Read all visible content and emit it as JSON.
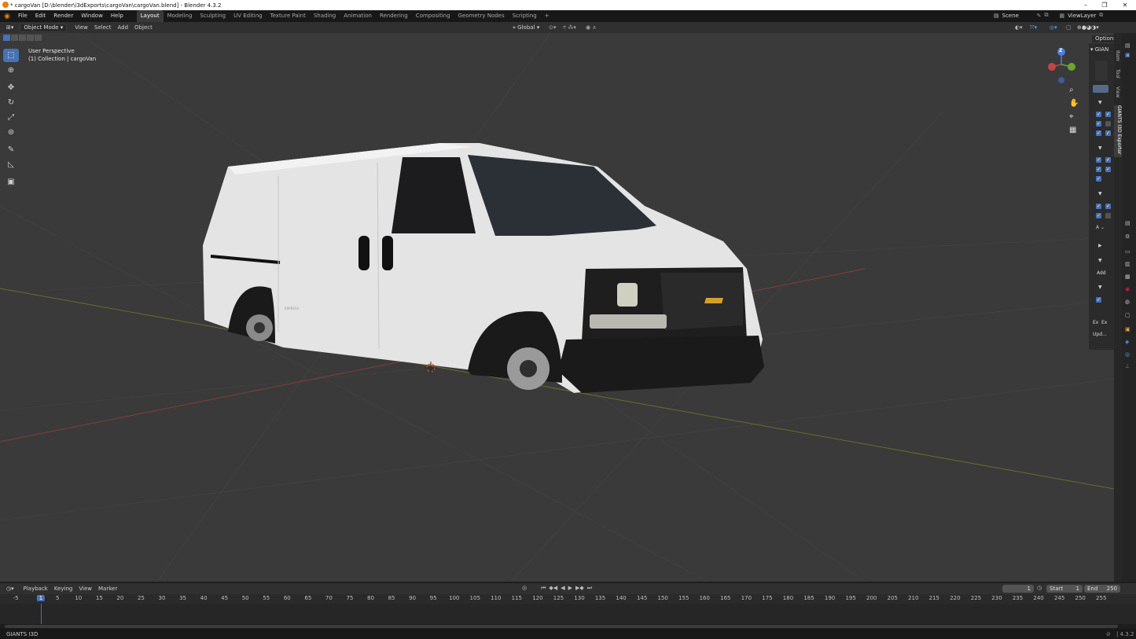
{
  "window": {
    "title": "* cargoVan [D:\\blender\\i3dExports\\cargoVan\\cargoVan.blend] - Blender 4.3.2"
  },
  "menu": [
    "File",
    "Edit",
    "Render",
    "Window",
    "Help"
  ],
  "workspaces": [
    "Layout",
    "Modeling",
    "Sculpting",
    "UV Editing",
    "Texture Paint",
    "Shading",
    "Animation",
    "Rendering",
    "Compositing",
    "Geometry Nodes",
    "Scripting"
  ],
  "topright": {
    "scene": "Scene",
    "view_layer": "ViewLayer"
  },
  "viewport_header": {
    "mode": "Object Mode",
    "menus": [
      "View",
      "Select",
      "Add",
      "Object"
    ],
    "orientation": "Global",
    "options": "Options"
  },
  "viewport": {
    "perspective": "User Perspective",
    "collection": "(1) Collection | cargoVan",
    "vehicle_badge": "EXPRESS"
  },
  "gizmo": {
    "z": "Z"
  },
  "npanel": {
    "header": "GIAN",
    "tabs": [
      "Item",
      "Tool",
      "View",
      "GIANTS I3D Exporter"
    ],
    "add": "Add",
    "a_label": "A",
    "ex1": "Ex",
    "ex2": "Ex",
    "update": "Upd..."
  },
  "timeline": {
    "menus": [
      "Playback",
      "Keying",
      "View",
      "Marker"
    ],
    "current_frame": "1",
    "start_label": "Start",
    "start": "1",
    "end_label": "End",
    "end": "250",
    "ruler": [
      "-5",
      "1",
      "5",
      "10",
      "15",
      "20",
      "25",
      "30",
      "35",
      "40",
      "45",
      "50",
      "55",
      "60",
      "65",
      "70",
      "75",
      "80",
      "85",
      "90",
      "95",
      "100",
      "105",
      "110",
      "115",
      "120",
      "125",
      "130",
      "135",
      "140",
      "145",
      "150",
      "155",
      "160",
      "165",
      "170",
      "175",
      "180",
      "185",
      "190",
      "195",
      "200",
      "205",
      "210",
      "215",
      "220",
      "225",
      "230",
      "235",
      "240",
      "245",
      "250",
      "255"
    ]
  },
  "status": {
    "left": "GIANTS I3D",
    "version": "4.3.2"
  },
  "colors": {
    "accent": "#4772b3",
    "viewport_bg": "#3a3a3a",
    "blender_orange": "#e87d0d"
  }
}
